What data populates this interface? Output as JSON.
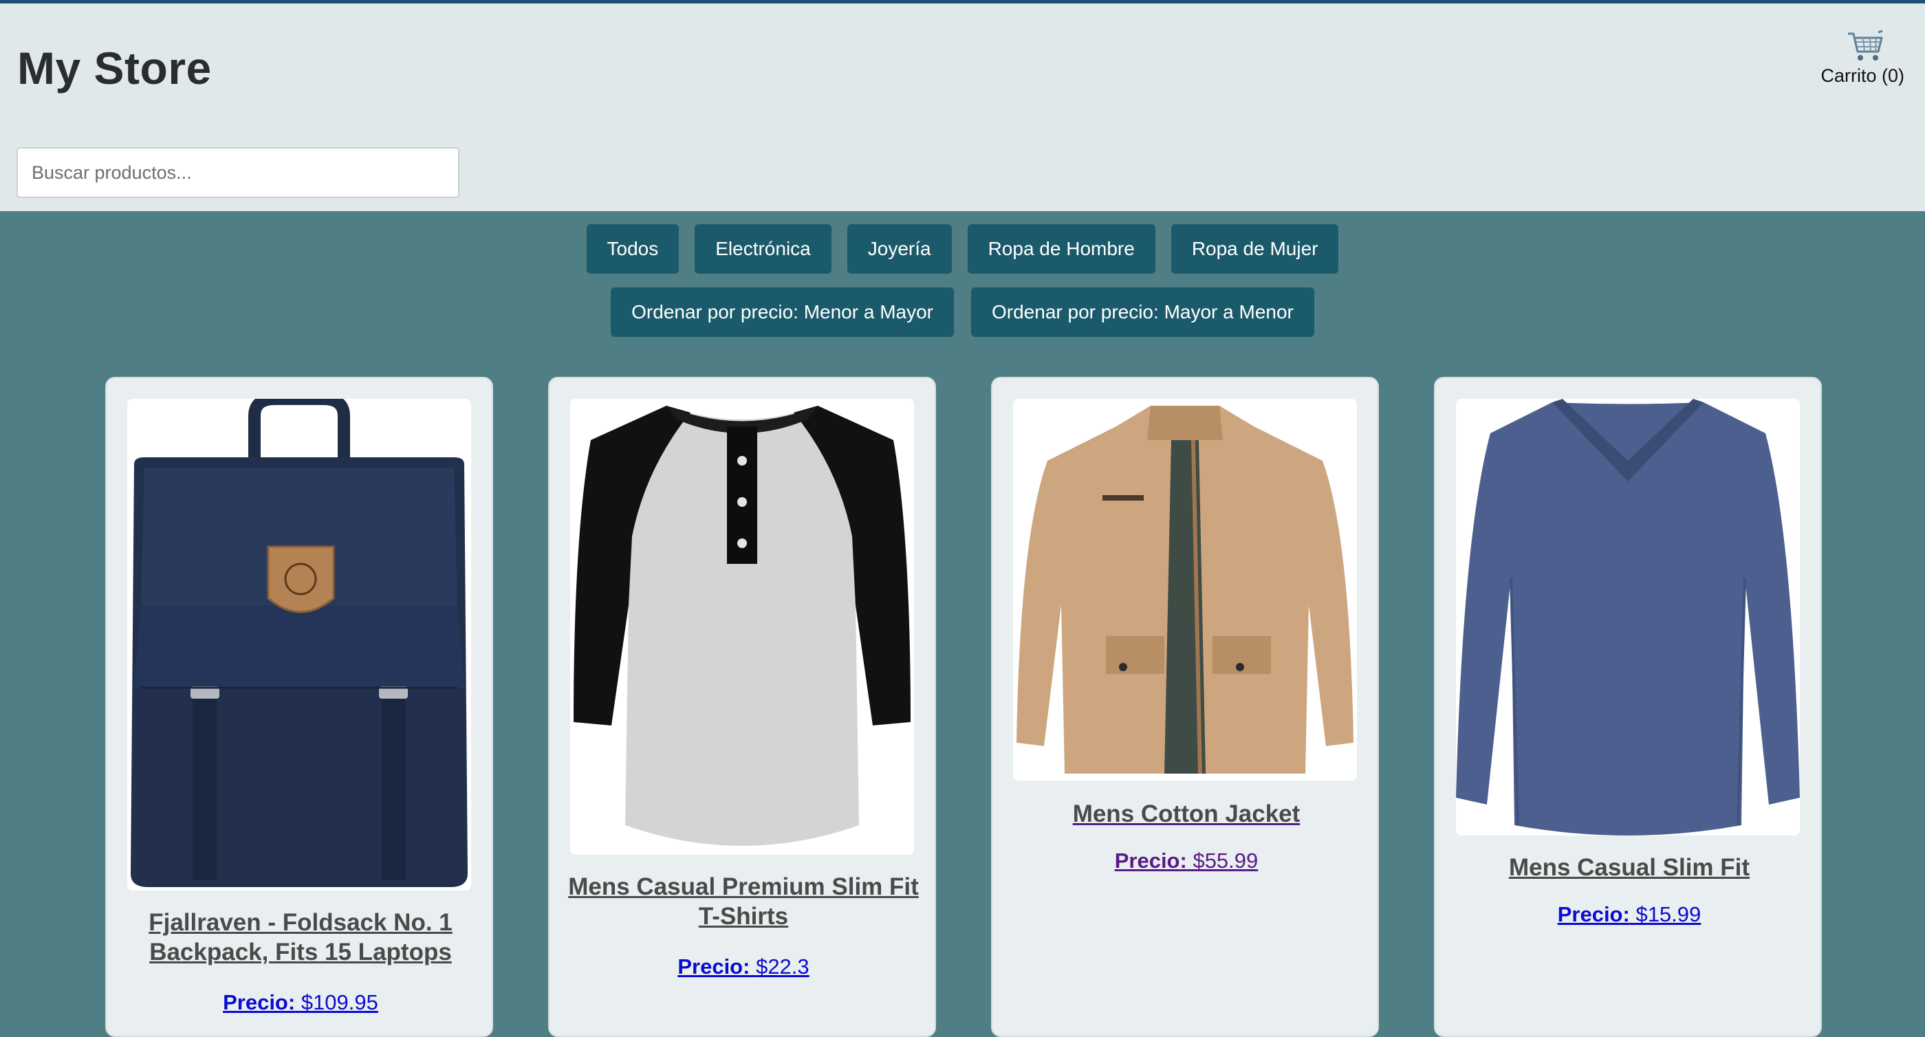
{
  "header": {
    "title": "My Store",
    "cart_label": "Carrito (0)",
    "cart_icon": "shopping-cart-icon"
  },
  "search": {
    "placeholder": "Buscar productos...",
    "value": ""
  },
  "filters": [
    "Todos",
    "Electrónica",
    "Joyería",
    "Ropa de Hombre",
    "Ropa de Mujer"
  ],
  "sorts": [
    "Ordenar por precio: Menor a Mayor",
    "Ordenar por precio: Mayor a Menor"
  ],
  "colors": {
    "page_background": "#4f7e84",
    "header_background": "#e1e8ea",
    "button": "#1b5a6a",
    "card_background": "#e9eff0",
    "price_link": "#0b0bd0",
    "price_visited": "#5a1a86"
  },
  "products": [
    {
      "title": "Fjallraven - Foldsack No. 1 Backpack, Fits 15 Laptops",
      "price_label": "Precio:",
      "price": "$109.95",
      "image": "navy-backpack"
    },
    {
      "title": "Mens Casual Premium Slim Fit T-Shirts",
      "price_label": "Precio:",
      "price": "$22.3",
      "image": "raglan-henley-tshirt"
    },
    {
      "title": "Mens Cotton Jacket",
      "price_label": "Precio:",
      "price": "$55.99",
      "image": "khaki-cotton-jacket"
    },
    {
      "title": "Mens Casual Slim Fit",
      "price_label": "Precio:",
      "price": "$15.99",
      "image": "blue-long-sleeve-shirt"
    }
  ]
}
